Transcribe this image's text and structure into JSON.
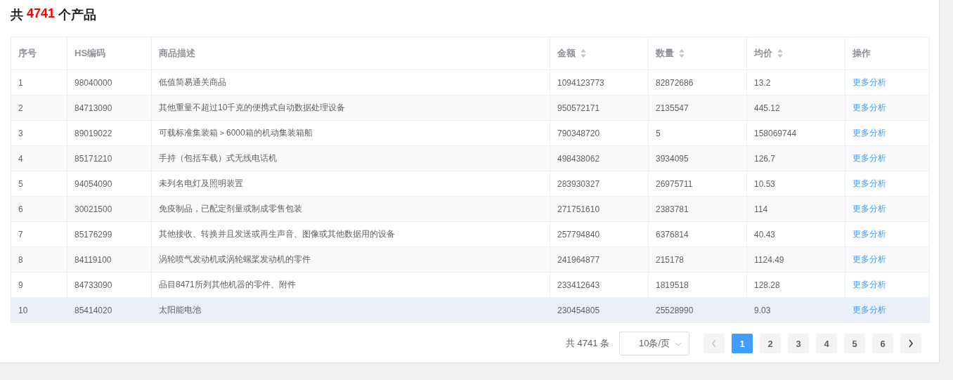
{
  "title": {
    "prefix": "共",
    "count": "4741",
    "suffix": "个产品"
  },
  "table": {
    "columns": [
      {
        "label": "序号",
        "sortable": false
      },
      {
        "label": "HS编码",
        "sortable": false
      },
      {
        "label": "商品描述",
        "sortable": false
      },
      {
        "label": "金额",
        "sortable": true
      },
      {
        "label": "数量",
        "sortable": true
      },
      {
        "label": "均价",
        "sortable": true
      },
      {
        "label": "操作",
        "sortable": false
      }
    ],
    "rows": [
      {
        "cells": [
          "1",
          "98040000",
          "低值简易通关商品",
          "1094123773",
          "82872686",
          "13.2"
        ],
        "action": "更多分析",
        "highlighted": false
      },
      {
        "cells": [
          "2",
          "84713090",
          "其他重量不超过10千克的便携式自动数据处理设备",
          "950572171",
          "2135547",
          "445.12"
        ],
        "action": "更多分析",
        "highlighted": false
      },
      {
        "cells": [
          "3",
          "89019022",
          "可载标准集装箱＞6000箱的机动集装箱船",
          "790348720",
          "5",
          "158069744"
        ],
        "action": "更多分析",
        "highlighted": false
      },
      {
        "cells": [
          "4",
          "85171210",
          "手持（包括车载）式无线电话机",
          "498438062",
          "3934095",
          "126.7"
        ],
        "action": "更多分析",
        "highlighted": false
      },
      {
        "cells": [
          "5",
          "94054090",
          "未列名电灯及照明装置",
          "283930327",
          "26975711",
          "10.53"
        ],
        "action": "更多分析",
        "highlighted": false
      },
      {
        "cells": [
          "6",
          "30021500",
          "免疫制品，已配定剂量或制成零售包装",
          "271751610",
          "2383781",
          "114"
        ],
        "action": "更多分析",
        "highlighted": false
      },
      {
        "cells": [
          "7",
          "85176299",
          "其他接收、转换并且发送或再生声音、图像或其他数据用的设备",
          "257794840",
          "6376814",
          "40.43"
        ],
        "action": "更多分析",
        "highlighted": false
      },
      {
        "cells": [
          "8",
          "84119100",
          "涡轮喷气发动机或涡轮螺桨发动机的零件",
          "241964877",
          "215178",
          "1124.49"
        ],
        "action": "更多分析",
        "highlighted": false
      },
      {
        "cells": [
          "9",
          "84733090",
          "品目8471所列其他机器的零件、附件",
          "233412643",
          "1819518",
          "128.28"
        ],
        "action": "更多分析",
        "highlighted": false
      },
      {
        "cells": [
          "10",
          "85414020",
          "太阳能电池",
          "230454805",
          "25528990",
          "9.03"
        ],
        "action": "更多分析",
        "highlighted": true
      }
    ]
  },
  "pagination": {
    "total": "共 4741 条",
    "page_size": "10条/页",
    "pages": [
      {
        "label": "1",
        "selected": true
      },
      {
        "label": "2",
        "selected": false
      },
      {
        "label": "3",
        "selected": false
      },
      {
        "label": "4",
        "selected": false
      },
      {
        "label": "5",
        "selected": false
      },
      {
        "label": "6",
        "selected": false
      }
    ]
  }
}
